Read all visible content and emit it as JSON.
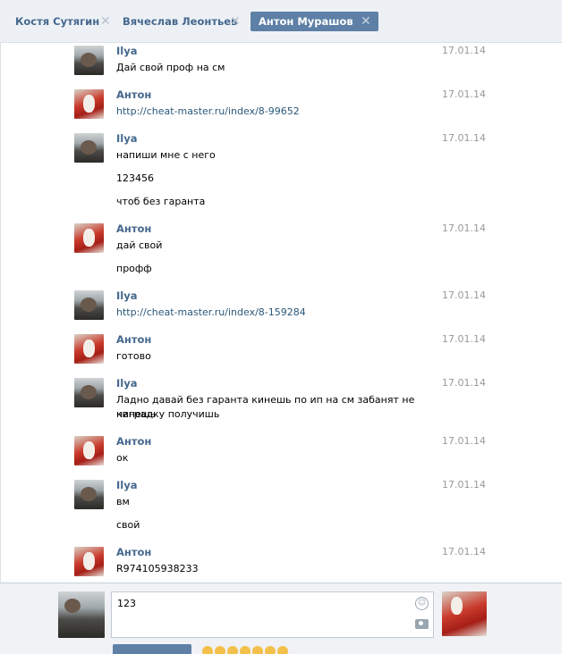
{
  "tabs": [
    {
      "label": "Костя Сутягин",
      "active": false
    },
    {
      "label": "Вячеслав Леонтьев",
      "active": false
    },
    {
      "label": "Антон Мурашов",
      "active": true
    }
  ],
  "messages": [
    {
      "author": "Ilya",
      "date": "17.01.14",
      "lines": [
        "Дай свой проф на см"
      ]
    },
    {
      "author": "Антон",
      "date": "17.01.14",
      "lines": [
        "http://cheat-master.ru/index/8-99652"
      ],
      "link": true
    },
    {
      "author": "Ilya",
      "date": "17.01.14",
      "lines": [
        "напиши мне с него",
        "123456",
        "чтоб без гаранта"
      ]
    },
    {
      "author": "Антон",
      "date": "17.01.14",
      "lines": [
        "дай свой",
        "профф"
      ]
    },
    {
      "author": "Ilya",
      "date": "17.01.14",
      "lines": [
        "http://cheat-master.ru/index/8-159284"
      ],
      "link": true
    },
    {
      "author": "Антон",
      "date": "17.01.14",
      "lines": [
        "готово"
      ]
    },
    {
      "author": "Ilya",
      "date": "17.01.14",
      "lines": [
        "Ладно давай без гаранта кинешь по ип на см забанят не кинешь",
        "наградку получишь"
      ]
    },
    {
      "author": "Антон",
      "date": "17.01.14",
      "lines": [
        "ок"
      ]
    },
    {
      "author": "Ilya",
      "date": "17.01.14",
      "lines": [
        "вм",
        "свой"
      ]
    },
    {
      "author": "Антон",
      "date": "17.01.14",
      "lines": [
        "R974105938233"
      ]
    }
  ],
  "composer": {
    "input_value": "123"
  },
  "icons": {
    "tab_close": "close-icon",
    "smile": "smile-icon",
    "camera": "camera-icon"
  },
  "colors": {
    "accent": "#5e80a6",
    "name_link": "#45688e",
    "url_link": "#2b587a",
    "date": "#999999"
  }
}
